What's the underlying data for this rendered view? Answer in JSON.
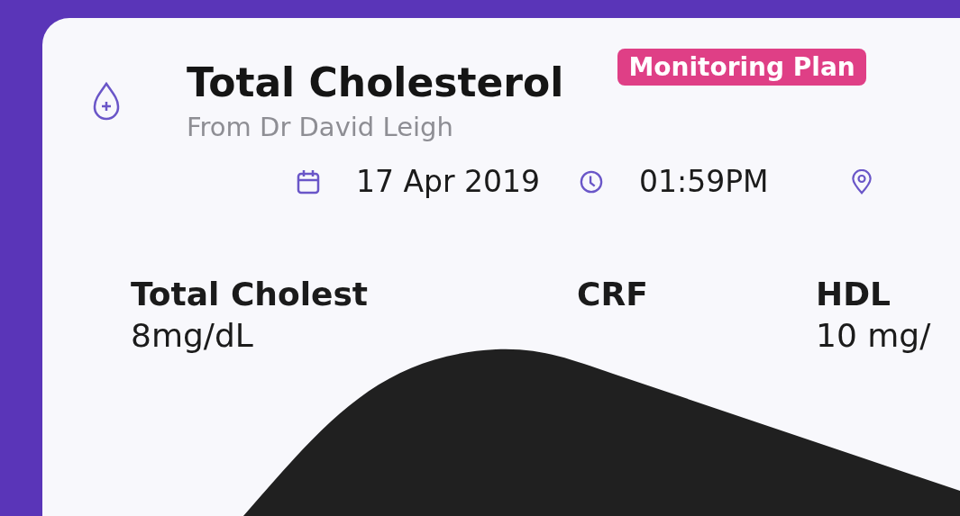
{
  "card": {
    "title": "Total Cholesterol",
    "subtitle": "From Dr David Leigh",
    "badge": "Monitoring Plan",
    "date": "17 Apr 2019",
    "time": "01:59PM",
    "metrics": [
      {
        "label": "Total Cholest",
        "value": "8mg/dL"
      },
      {
        "label": "CRF"
      },
      {
        "label": "HDL",
        "value": "10 mg/"
      }
    ]
  }
}
